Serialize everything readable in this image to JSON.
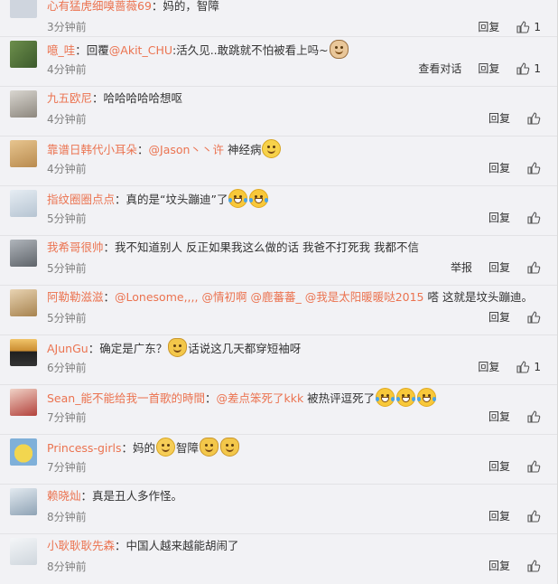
{
  "actions": {
    "reply": "回复",
    "view_conversation": "查看对话",
    "report": "举报"
  },
  "comments": [
    {
      "user": "心有猛虎细嗅蔷薇69",
      "sep": "：",
      "text": "妈的，智障",
      "time": "3分钟前",
      "likes": "1",
      "avatar_color": "#cfd5de"
    },
    {
      "user": "噫_哇",
      "sep": "：",
      "pre": "回覆",
      "mention": "@Akit_CHU",
      "text": ":活久见..敢跳就不怕被看上吗~",
      "time": "4分钟前",
      "likes": "1",
      "avatar_color": "#4a6b3a",
      "emoji": "dog"
    },
    {
      "user": "九五欧尼",
      "sep": "：",
      "text": "哈哈哈哈哈想呕",
      "time": "4分钟前",
      "avatar_color": "#b7b2aa"
    },
    {
      "user": "靠谱日韩代小耳朵",
      "sep": "：",
      "mention": "@Jason丶丶许",
      "text": " 神经病",
      "time": "4分钟前",
      "avatar_color": "#d8b37a",
      "emoji": "dizzy"
    },
    {
      "user": "指纹圈圈点点",
      "sep": "：",
      "text": "真的是“坟头蹦迪”了",
      "time": "5分钟前",
      "avatar_color": "#d2dbe6"
    },
    {
      "user": "我希哥很帅",
      "sep": "：",
      "text": "我不知道别人 反正如果我这么做的话 我爸不打死我 我都不信",
      "time": "5分钟前",
      "avatar_color": "#8a8f96"
    },
    {
      "user": "阿勒勒滋滋",
      "sep": "：",
      "mentions": [
        "@Lonesome,,,,",
        "@情初啊",
        "@鹿蕃蕃_",
        "@我是太阳暖暖哒2015"
      ],
      "text": " 嗒 这就是坟头蹦迪。",
      "time": "5分钟前",
      "avatar_color": "#c9a77d"
    },
    {
      "user": "AJunGu",
      "sep": "：",
      "text": "确定是广东？",
      "text2": "话说这几天都穿短袖呀",
      "time": "6分钟前",
      "likes": "1",
      "avatar_color": "#3a3a3a"
    },
    {
      "user": "Sean_能不能给我一首歌的時間",
      "sep": "：",
      "mention": "@差点笨死了kkk",
      "text": " 被热评逗死了",
      "time": "7分钟前",
      "avatar_color": "#c0504d"
    },
    {
      "user": "Princess-girls",
      "sep": "：",
      "text": "妈的",
      "text2": "智障",
      "time": "7分钟前",
      "avatar_color": "#e8d15a"
    },
    {
      "user": "赖晓灿",
      "sep": "：",
      "text": "真是丑人多作怪。",
      "time": "8分钟前",
      "avatar_color": "#b5c8d6"
    },
    {
      "user": "小耿耿耿先森",
      "sep": "：",
      "text": "中国人越来越能胡闹了",
      "time": "8分钟前",
      "avatar_color": "#dfe3e8"
    }
  ]
}
